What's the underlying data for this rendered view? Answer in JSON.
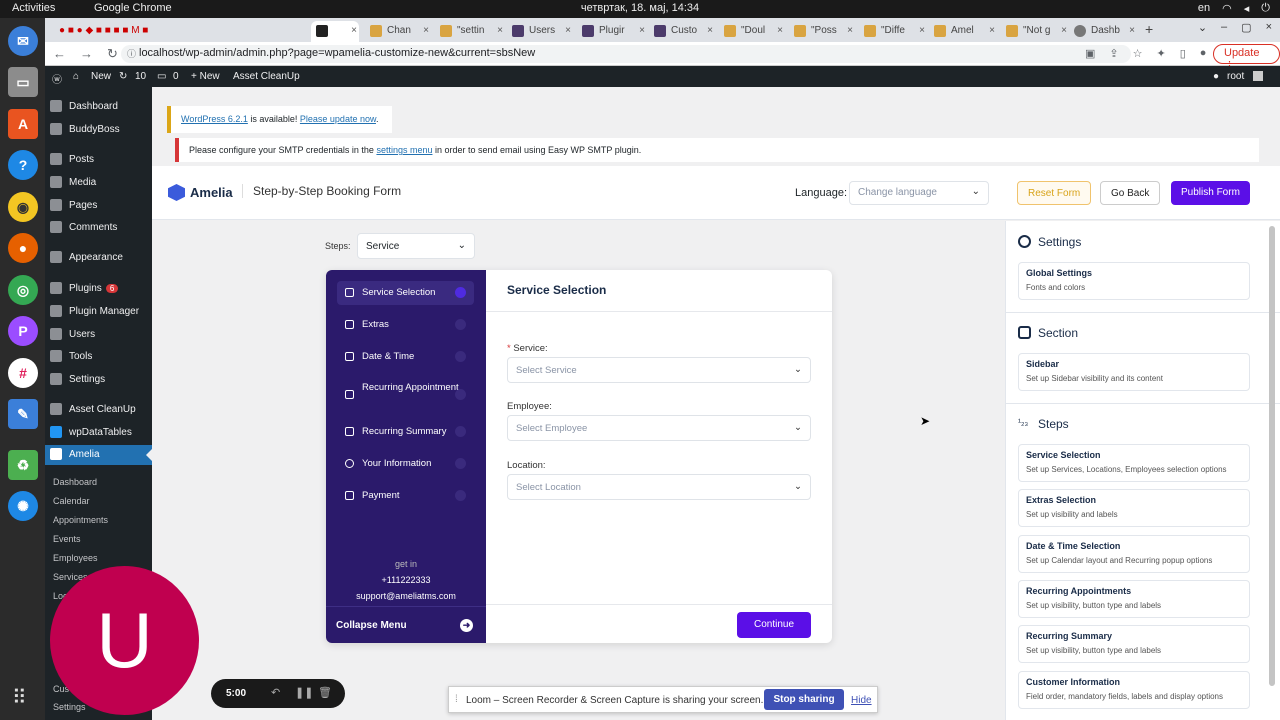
{
  "os": {
    "activities": "Activities",
    "app": "Google Chrome",
    "clock": "четвртак, 18. мај, 14:34",
    "lang": "en"
  },
  "browser": {
    "tabs": [
      "Chan",
      "\"settin",
      "Users",
      "Plugir",
      "Custo",
      "\"Doul",
      "\"Poss",
      "\"Diffe",
      "Amel",
      "\"Not g",
      "Dashb"
    ],
    "url": "localhost/wp-admin/admin.php?page=wpamelia-customize-new&current=sbsNew",
    "update_label": "Update"
  },
  "adminbar": {
    "new_top": "New",
    "updates_count": "10",
    "comments_count": "0",
    "new_label": "+ New",
    "asset": "Asset CleanUp",
    "user": "root"
  },
  "sidebar": {
    "items": [
      "Dashboard",
      "BuddyBoss",
      "Posts",
      "Media",
      "Pages",
      "Comments",
      "Appearance",
      "Plugins",
      "Plugin Manager",
      "Users",
      "Tools",
      "Settings",
      "Asset CleanUp",
      "wpDataTables",
      "Amelia"
    ],
    "plugins_badge": "6",
    "submenu": [
      "Dashboard",
      "Calendar",
      "Appointments",
      "Events",
      "Employees",
      "Services",
      "Loc",
      "Cus",
      "Settings"
    ]
  },
  "notices": {
    "update_link1": "WordPress 6.2.1",
    "update_text": " is available! ",
    "update_link2": "Please update now",
    "update_end": ".",
    "smtp_text1": "Please configure your SMTP credentials in the ",
    "smtp_link": "settings menu",
    "smtp_text2": " in order to send email using Easy WP SMTP plugin."
  },
  "amelia": {
    "logo": "Amelia",
    "title": "Step-by-Step Booking Form",
    "language_label": "Language:",
    "language_placeholder": "Change language",
    "reset": "Reset Form",
    "back": "Go Back",
    "publish": "Publish Form",
    "steps_label": "Steps:",
    "steps_value": "Service"
  },
  "form": {
    "sidebar_steps": [
      "Service Selection",
      "Extras",
      "Date & Time",
      "Recurring Appointment",
      "Recurring Summary",
      "Your Information",
      "Payment"
    ],
    "get_in": "get in",
    "phone": "+111222333",
    "email": "support@ameliatms.com",
    "collapse": "Collapse Menu",
    "heading": "Service Selection",
    "service_label": "Service:",
    "service_placeholder": "Select Service",
    "employee_label": "Employee:",
    "employee_placeholder": "Select Employee",
    "location_label": "Location:",
    "location_placeholder": "Select Location",
    "continue": "Continue"
  },
  "panel": {
    "settings_title": "Settings",
    "global_title": "Global Settings",
    "global_desc": "Fonts and colors",
    "section_title": "Section",
    "sidebar_title": "Sidebar",
    "sidebar_desc": "Set up Sidebar visibility and its content",
    "steps_title": "Steps",
    "steps": [
      {
        "t": "Service Selection",
        "d": "Set up Services, Locations, Employees selection options"
      },
      {
        "t": "Extras Selection",
        "d": "Set up visibility and labels"
      },
      {
        "t": "Date & Time Selection",
        "d": "Set up Calendar layout and Recurring popup options"
      },
      {
        "t": "Recurring Appointments",
        "d": "Set up visibility, button type and labels"
      },
      {
        "t": "Recurring Summary",
        "d": "Set up visibility, button type and labels"
      },
      {
        "t": "Customer Information",
        "d": "Field order, mandatory fields, labels and display options"
      }
    ]
  },
  "loom": {
    "avatar_letter": "U",
    "time": "5:00",
    "message": "Loom – Screen Recorder & Screen Capture is sharing your screen.",
    "stop": "Stop sharing",
    "hide": "Hide"
  },
  "colors": {
    "accent": "#5b0fe7",
    "sidebar_form": "#2b1a6b",
    "wp_blue": "#2271b1",
    "avatar": "#c0004f"
  }
}
